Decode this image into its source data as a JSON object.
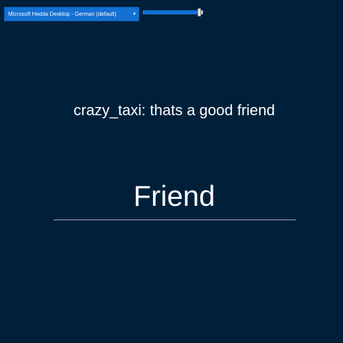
{
  "voice_select": {
    "selected": "Microsoft Hedda Desktop - German (default)",
    "arrow": "▼"
  },
  "rate_slider": {
    "level": 0.96
  },
  "message": {
    "text": "crazy_taxi: thats a good friend"
  },
  "word": {
    "text": "Friend"
  },
  "colors": {
    "background": "#00203a",
    "accent": "#1470d2",
    "text": "#ffffff",
    "divider": "#a8b2bc"
  }
}
